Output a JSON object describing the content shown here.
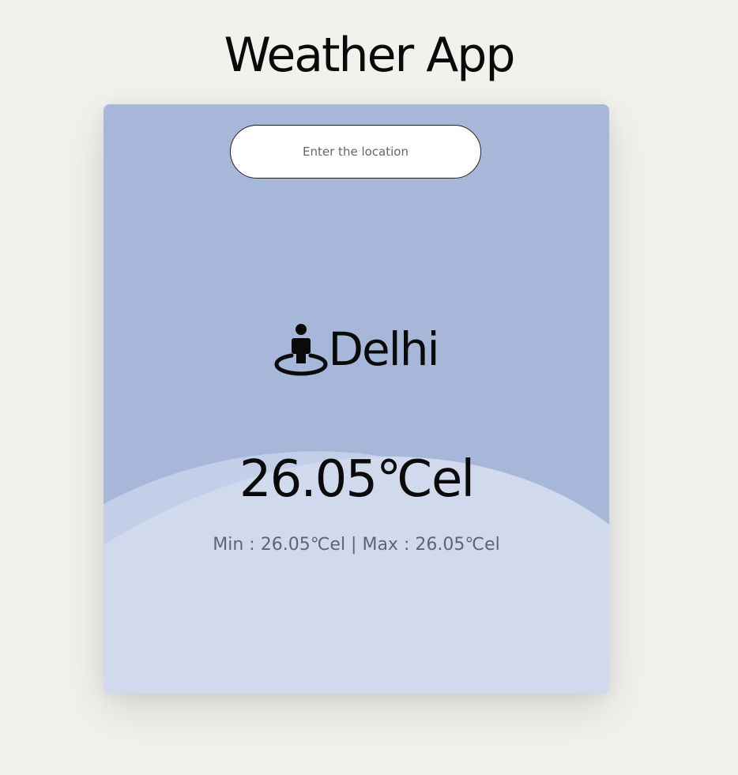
{
  "app": {
    "title": "Weather App"
  },
  "search": {
    "placeholder": "Enter the location",
    "value": ""
  },
  "weather": {
    "location_icon": "person-pin-icon",
    "city": "Delhi",
    "temperature": "26.05℃el",
    "min_label": "Min : ",
    "min_value": "26.05℃el",
    "separator": " | ",
    "max_label": "Max : ",
    "max_value": "26.05℃el"
  },
  "colors": {
    "background": "#f2f1ed",
    "card_top": "#a6b7da",
    "card_wave": "#d1daec",
    "text_primary": "#0a0a0a",
    "text_secondary": "#5e6474"
  }
}
